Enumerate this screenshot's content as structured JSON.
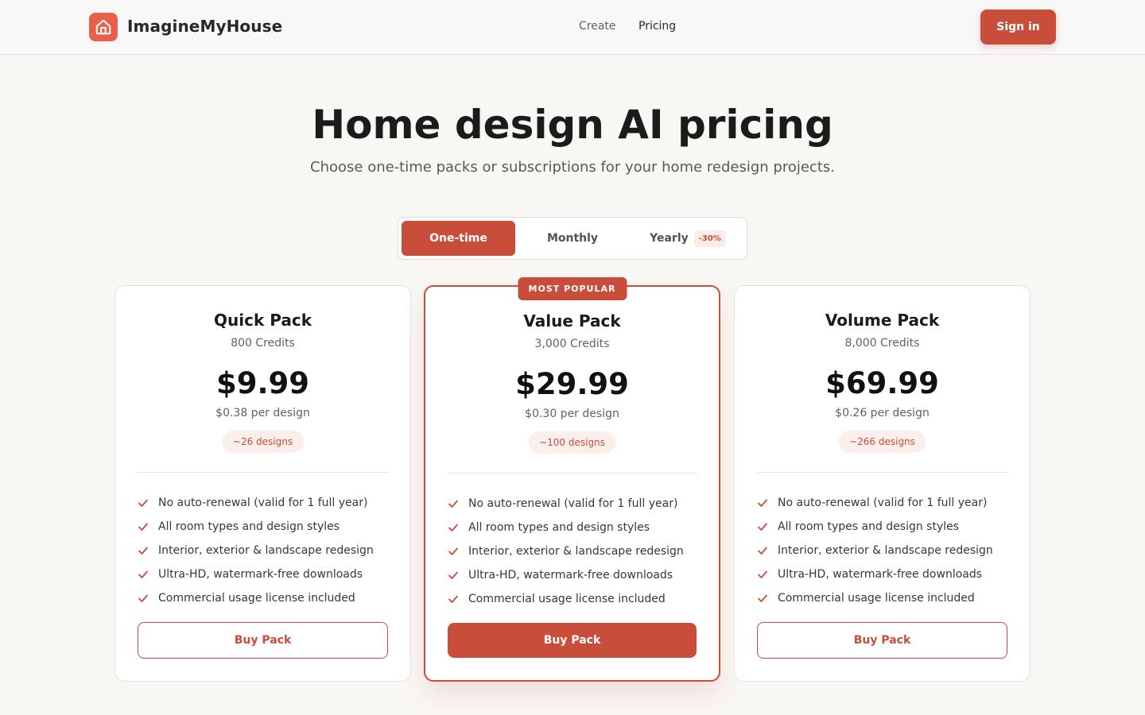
{
  "app": {
    "brand": "ImagineMyHouse",
    "nav": [
      {
        "label": "Create"
      },
      {
        "label": "Pricing"
      }
    ],
    "sign_in": "Sign in",
    "accent": "#c84d3a"
  },
  "hero": {
    "title": "Home design AI pricing",
    "subtitle": "Choose one-time packs or subscriptions for your home redesign projects."
  },
  "billing_toggle": {
    "options": [
      {
        "label": "One-time",
        "selected": true
      },
      {
        "label": "Monthly",
        "selected": false
      },
      {
        "label": "Yearly",
        "selected": false,
        "badge": "-30%"
      }
    ]
  },
  "plans": [
    {
      "name": "Quick Pack",
      "credits": "800 Credits",
      "price": "$9.99",
      "per_design": "$0.38 per design",
      "designs": "~26 designs",
      "features": [
        "No auto-renewal (valid for 1 full year)",
        "All room types and design styles",
        "Interior, exterior & landscape redesign",
        "Ultra-HD, watermark-free downloads",
        "Commercial usage license included"
      ],
      "button": "Buy Pack"
    },
    {
      "name": "Value Pack",
      "badge": "MOST POPULAR",
      "credits": "3,000 Credits",
      "price": "$29.99",
      "per_design": "$0.30 per design",
      "designs": "~100 designs",
      "features": [
        "No auto-renewal (valid for 1 full year)",
        "All room types and design styles",
        "Interior, exterior & landscape redesign",
        "Ultra-HD, watermark-free downloads",
        "Commercial usage license included"
      ],
      "button": "Buy Pack"
    },
    {
      "name": "Volume Pack",
      "credits": "8,000 Credits",
      "price": "$69.99",
      "per_design": "$0.26 per design",
      "designs": "~266 designs",
      "features": [
        "No auto-renewal (valid for 1 full year)",
        "All room types and design styles",
        "Interior, exterior & landscape redesign",
        "Ultra-HD, watermark-free downloads",
        "Commercial usage license included"
      ],
      "button": "Buy Pack"
    }
  ]
}
